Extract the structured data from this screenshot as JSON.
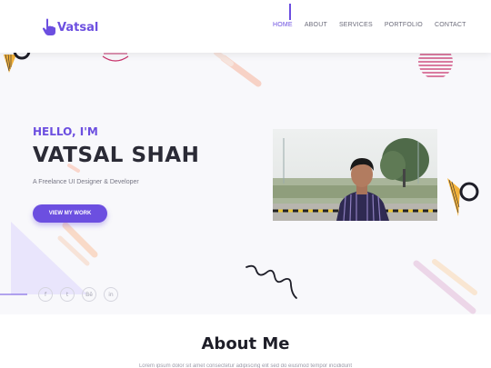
{
  "brand": {
    "name": "Vatsal",
    "logo_icon": "hand-pointer-icon",
    "color": "#6c4fe0"
  },
  "nav": {
    "items": [
      {
        "label": "HOME",
        "active": true
      },
      {
        "label": "ABOUT",
        "active": false
      },
      {
        "label": "SERVICES",
        "active": false
      },
      {
        "label": "PORTFOLIO",
        "active": false
      },
      {
        "label": "CONTACT",
        "active": false
      }
    ]
  },
  "hero": {
    "greeting": "HELLO, I'M",
    "name": "VATSAL SHAH",
    "tagline": "A Freelance UI Designer & Developer",
    "cta_label": "VIEW MY WORK"
  },
  "socials": [
    {
      "glyph": "f",
      "icon": "facebook-icon"
    },
    {
      "glyph": "t",
      "icon": "twitter-icon"
    },
    {
      "glyph": "Bē",
      "icon": "behance-icon"
    },
    {
      "glyph": "in",
      "icon": "linkedin-icon"
    }
  ],
  "about": {
    "title": "About Me",
    "snippet": "Lorem ipsum dolor sit amet consectetur adipiscing elit sed do eiusmod tempor incididunt"
  },
  "colors": {
    "accent": "#6c4fe0",
    "text_dark": "#2b2b36",
    "hero_bg": "#f8f8fb"
  }
}
